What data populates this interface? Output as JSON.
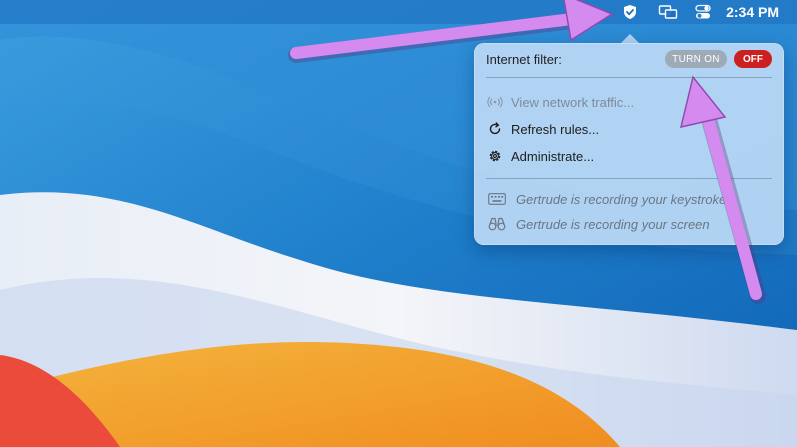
{
  "menubar": {
    "clock": "2:34 PM",
    "icons": [
      "shield-check-icon",
      "screen-mirroring-icon",
      "control-center-icon"
    ]
  },
  "popup": {
    "filter_label": "Internet filter:",
    "turn_on_label": "TURN ON",
    "off_label": "OFF",
    "items": [
      {
        "label": "View network traffic...",
        "icon": "network-antenna-icon",
        "enabled": false
      },
      {
        "label": "Refresh rules...",
        "icon": "refresh-icon",
        "enabled": true
      },
      {
        "label": "Administrate...",
        "icon": "gear-icon",
        "enabled": true
      }
    ],
    "status": [
      {
        "label": "Gertrude is recording your keystrokes",
        "icon": "keyboard-icon"
      },
      {
        "label": "Gertrude is recording your screen",
        "icon": "binoculars-icon"
      }
    ]
  },
  "colors": {
    "menubar_bg": "#1e6ebe",
    "popup_bg": "#bad8f5",
    "off_button": "#cc1f1f",
    "turn_on_button": "#9eaab6",
    "annotation_arrow": "#d58af0"
  }
}
